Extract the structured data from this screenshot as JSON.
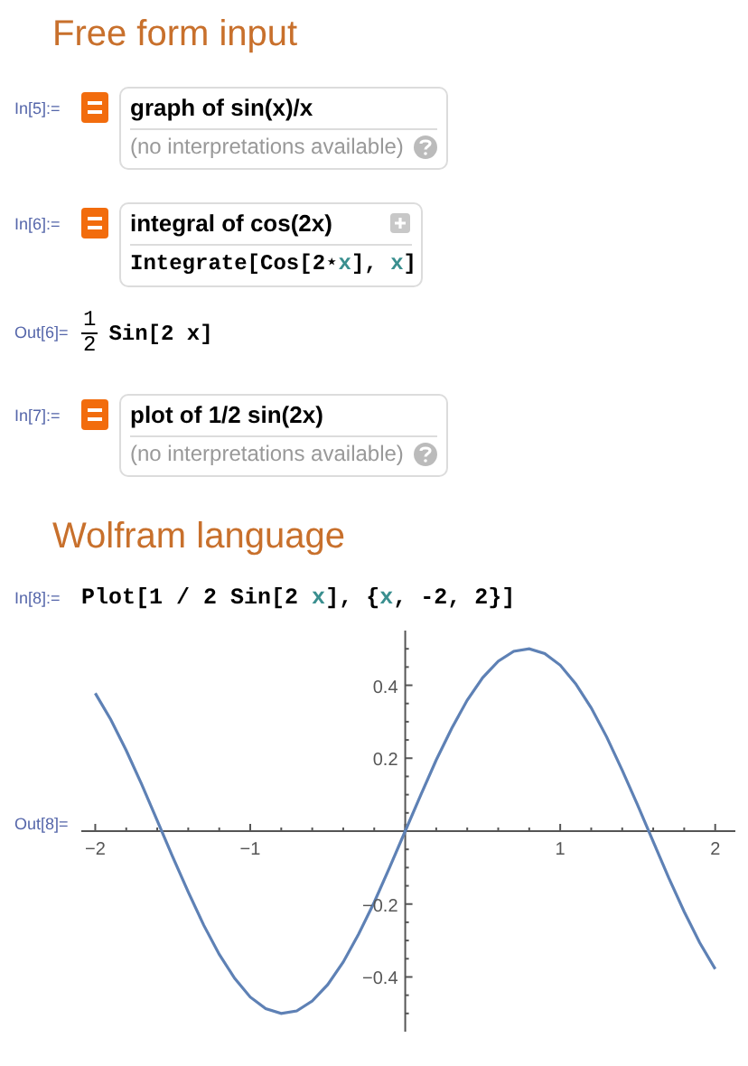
{
  "sections": [
    {
      "title": "Free form input",
      "cells": [
        {
          "kind": "freeform",
          "label": "In[5]:=",
          "query": "graph of sin(x)/x",
          "result": "(no interpretations available)"
        },
        {
          "kind": "freeform_code",
          "label": "In[6]:=",
          "query": "integral of cos(2x)",
          "code": [
            {
              "kind": "sym",
              "text": "Integrate[Cos[2"
            },
            {
              "kind": "sym",
              "text": "⋆"
            },
            {
              "kind": "var",
              "text": "x"
            },
            {
              "kind": "sym",
              "text": "],"
            },
            {
              "kind": "var",
              "text": "x"
            },
            {
              "kind": "sym",
              "text": "]"
            }
          ]
        },
        {
          "kind": "fraction_output",
          "label": "Out[6]=",
          "numerator": "1",
          "denominator": "2",
          "expression": "Sin[2 x]"
        },
        {
          "kind": "freeform",
          "label": "In[7]:=",
          "query": "plot of 1/2 sin(2x)",
          "result": "(no interpretations available)"
        }
      ]
    },
    {
      "title": "Wolfram language",
      "cells": [
        {
          "kind": "input",
          "label": "In[8]:=",
          "code": [
            {
              "kind": "sym",
              "text": "Plot[1 / 2 Sin[2"
            },
            {
              "kind": "var",
              "text": "x"
            },
            {
              "kind": "sym",
              "text": "], {"
            },
            {
              "kind": "var",
              "text": "x"
            },
            {
              "kind": "sym",
              "text": ", -2, 2}]"
            }
          ]
        },
        {
          "kind": "plot_output",
          "label": "Out[8]=",
          "chart_data": {
            "type": "line",
            "x": [
              -2,
              -1.9,
              -1.8,
              -1.7,
              -1.6,
              -1.5,
              -1.4,
              -1.3,
              -1.2,
              -1.1,
              -1,
              -0.9,
              -0.8,
              -0.7,
              -0.6,
              -0.5,
              -0.4,
              -0.3,
              -0.2,
              -0.1,
              0,
              0.1,
              0.2,
              0.3,
              0.4,
              0.5,
              0.6,
              0.7,
              0.8,
              0.9,
              1,
              1.1,
              1.2,
              1.3,
              1.4,
              1.5,
              1.6,
              1.7,
              1.8,
              1.9,
              2
            ],
            "series": [
              {
                "color": "#5e81b5",
                "values": [
                  0.378,
                  0.306,
                  0.221,
                  0.128,
                  0.029,
                  -0.071,
                  -0.167,
                  -0.258,
                  -0.338,
                  -0.404,
                  -0.455,
                  -0.487,
                  -0.5,
                  -0.493,
                  -0.466,
                  -0.421,
                  -0.359,
                  -0.282,
                  -0.195,
                  -0.099,
                  0,
                  0.099,
                  0.195,
                  0.282,
                  0.359,
                  0.421,
                  0.466,
                  0.493,
                  0.5,
                  0.487,
                  0.455,
                  0.404,
                  0.338,
                  0.258,
                  0.167,
                  0.071,
                  -0.029,
                  -0.128,
                  -0.221,
                  -0.306,
                  -0.378
                ]
              }
            ],
            "xlim": [
              -2.09,
              2.13
            ],
            "ylim": [
              -0.55,
              0.55
            ],
            "xticks": [
              {
                "value": -2,
                "label": "−2"
              },
              {
                "value": -1,
                "label": "−1"
              },
              {
                "value": 1,
                "label": "1"
              },
              {
                "value": 2,
                "label": "2"
              }
            ],
            "yticks": [
              {
                "value": -0.4,
                "label": "−0.4"
              },
              {
                "value": -0.2,
                "label": "−0.2"
              },
              {
                "value": 0.2,
                "label": "0.2"
              },
              {
                "value": 0.4,
                "label": "0.4"
              }
            ]
          }
        }
      ]
    }
  ]
}
